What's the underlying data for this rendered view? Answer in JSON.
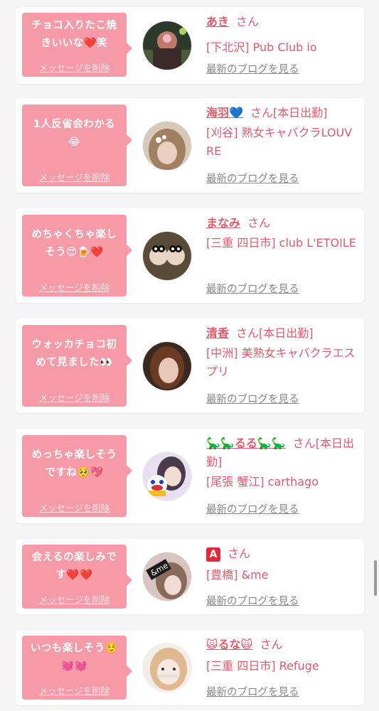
{
  "cards": [
    {
      "message": "チョコ入りたこ焼きいいな❤️笑",
      "delete_label": "メッセージを削除",
      "name": "あき",
      "honorific": "さん",
      "shop": "[下北沢] Pub Club io",
      "blog_label": "最新のブログを見る"
    },
    {
      "message": "1人反省会わかる😂",
      "delete_label": "メッセージを削除",
      "name": "海羽💙",
      "honorific": "さん[本日出勤]",
      "shop": "[刈谷] 熟女キャバクラLOUVRE",
      "blog_label": "最新のブログを見る"
    },
    {
      "message": "めちゃくちゃ楽しそう😍🍺❤️",
      "delete_label": "メッセージを削除",
      "name": "まなみ",
      "honorific": "さん",
      "shop": "[三重 四日市] club L'ETOILE",
      "blog_label": "最新のブログを見る"
    },
    {
      "message": "ウォッカチョコ初めて見ました👀",
      "delete_label": "メッセージを削除",
      "name": "清香",
      "honorific": "さん[本日出勤]",
      "shop": "[中洲] 美熟女キャバクラエスプリ",
      "blog_label": "最新のブログを見る"
    },
    {
      "message": "めっちゃ楽しそうですね🥺💖",
      "delete_label": "メッセージを削除",
      "name": "🦕🦕るる🦕🦕",
      "honorific": "さん[本日出勤]",
      "shop": "[尾張 蟹江] carthago",
      "blog_label": "最新のブログを見る"
    },
    {
      "message": "会えるの楽しみです❤️❤️",
      "delete_label": "メッセージを削除",
      "name": "A",
      "honorific": "さん",
      "shop": "[豊橋] &me",
      "blog_label": "最新のブログを見る"
    },
    {
      "message": "いつも楽しそう☺️💓💓",
      "delete_label": "メッセージを削除",
      "name": "🙀るな🙀",
      "honorific": "さん",
      "shop": "[三重 四日市] Refuge",
      "blog_label": "最新のブログを見る"
    }
  ],
  "colors": {
    "bubble": "#f79aa8",
    "accent": "#e05a6e",
    "link_gray": "#888888",
    "background": "#f5f5f5"
  }
}
